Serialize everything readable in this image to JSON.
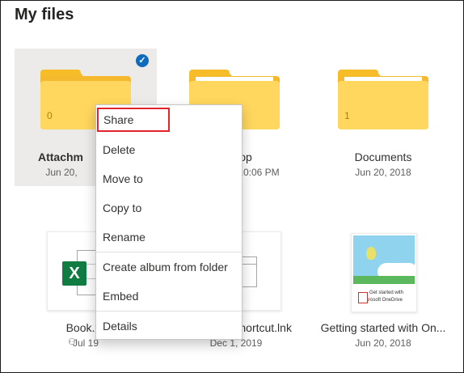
{
  "page_title": "My files",
  "items": {
    "attachments": {
      "name": "Attachm",
      "date": "Jun 20,",
      "count": "0"
    },
    "desktop": {
      "name": "op",
      "date": "10:06 PM"
    },
    "documents": {
      "name": "Documents",
      "date": "Jun 20, 2018",
      "count": "1"
    },
    "book": {
      "name": "Book.x",
      "date": "Jul 19",
      "icon_letter": "X"
    },
    "shortcut": {
      "name": "Shortcut.lnk",
      "date": "Dec 1, 2019"
    },
    "getting_started": {
      "name": "Getting started with On...",
      "date": "Jun 20, 2018",
      "thumb_text_1": "Get started with",
      "thumb_text_2": "crosoft OneDrive"
    }
  },
  "context_menu": {
    "items": [
      "Share",
      "Delete",
      "Move to",
      "Copy to",
      "Rename",
      "Create album from folder",
      "Embed",
      "Details"
    ]
  },
  "colors": {
    "folder_front": "#ffd75e",
    "folder_back": "#f5b92d",
    "selection_check": "#0f6cbd",
    "highlight_outline": "#e1242c",
    "excel_green": "#107c41"
  }
}
